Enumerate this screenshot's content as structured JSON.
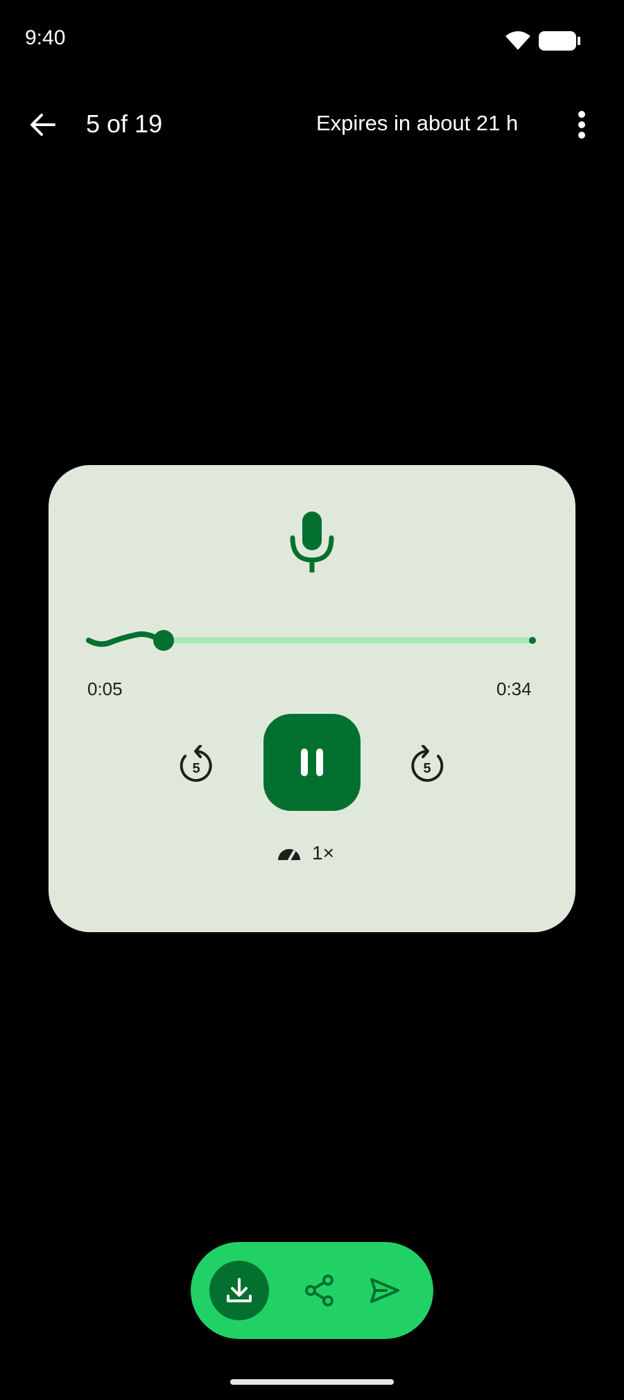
{
  "status_bar": {
    "time": "9:40"
  },
  "header": {
    "counter": "5 of 19",
    "expires": "Expires in about 21 h"
  },
  "player": {
    "current_time": "0:05",
    "total_time": "0:34",
    "progress": 0.15,
    "speed_label": "1×"
  },
  "icons": {
    "back": "arrow-left",
    "more": "more-vert",
    "mic": "microphone",
    "rewind": "replay-5",
    "forward": "forward-5",
    "pause": "pause",
    "speed": "speedometer",
    "download": "download",
    "share": "share",
    "send": "send"
  },
  "colors": {
    "background": "#000000",
    "card": "#e0e8dc",
    "accent_dark": "#04702f",
    "accent_light": "#22d166",
    "track": "#a6e8b8"
  }
}
